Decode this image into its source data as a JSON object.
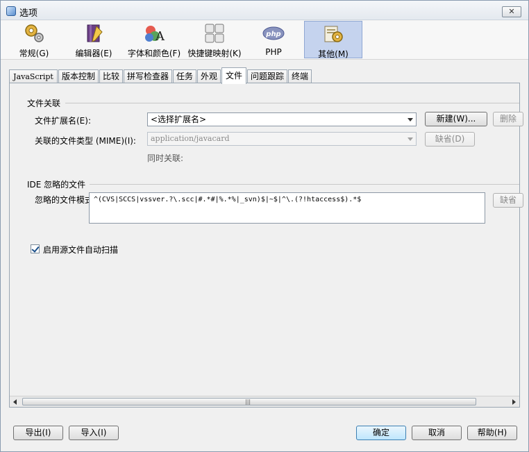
{
  "window": {
    "title": "选项"
  },
  "categories": [
    {
      "label": "常规(G)",
      "icon": "gears-icon"
    },
    {
      "label": "编辑器(E)",
      "icon": "editor-book-icon"
    },
    {
      "label": "字体和颜色(F)",
      "icon": "fonts-colors-icon"
    },
    {
      "label": "快捷键映射(K)",
      "icon": "keyboard-icon"
    },
    {
      "label": "PHP",
      "icon": "php-icon"
    },
    {
      "label": "其他(M)",
      "icon": "miscellaneous-icon",
      "selected": true
    }
  ],
  "tabs": [
    "JavaScript",
    "版本控制",
    "比较",
    "拼写检查器",
    "任务",
    "外观",
    "文件",
    "问题跟踪",
    "终端"
  ],
  "active_tab": "文件",
  "file_association": {
    "section_title": "文件关联",
    "ext_label": "文件扩展名(E):",
    "ext_value": "<选择扩展名>",
    "new_button": "新建(W)...",
    "remove_button": "删除",
    "mime_label": "关联的文件类型 (MIME)(I):",
    "mime_value": "application/javacard",
    "default_button": "缺省(D)",
    "also_assoc_label": "同时关联:"
  },
  "ignored_files": {
    "section_title": "IDE 忽略的文件",
    "pattern_label": "忽略的文件模式(F):",
    "pattern_value": "^(CVS|SCCS|vssver.?\\.scc|#.*#|%.*%|_svn)$|~$|^\\.(?!htaccess$).*$",
    "default_button": "缺省"
  },
  "auto_scan": {
    "label": "启用源文件自动扫描",
    "checked": true
  },
  "footer": {
    "export": "导出(I)",
    "import": "导入(I)",
    "ok": "确定",
    "cancel": "取消",
    "help": "帮助(H)"
  },
  "colors": {
    "selected_category": "#c5d3ee",
    "primary_button": "#bee6fd"
  }
}
